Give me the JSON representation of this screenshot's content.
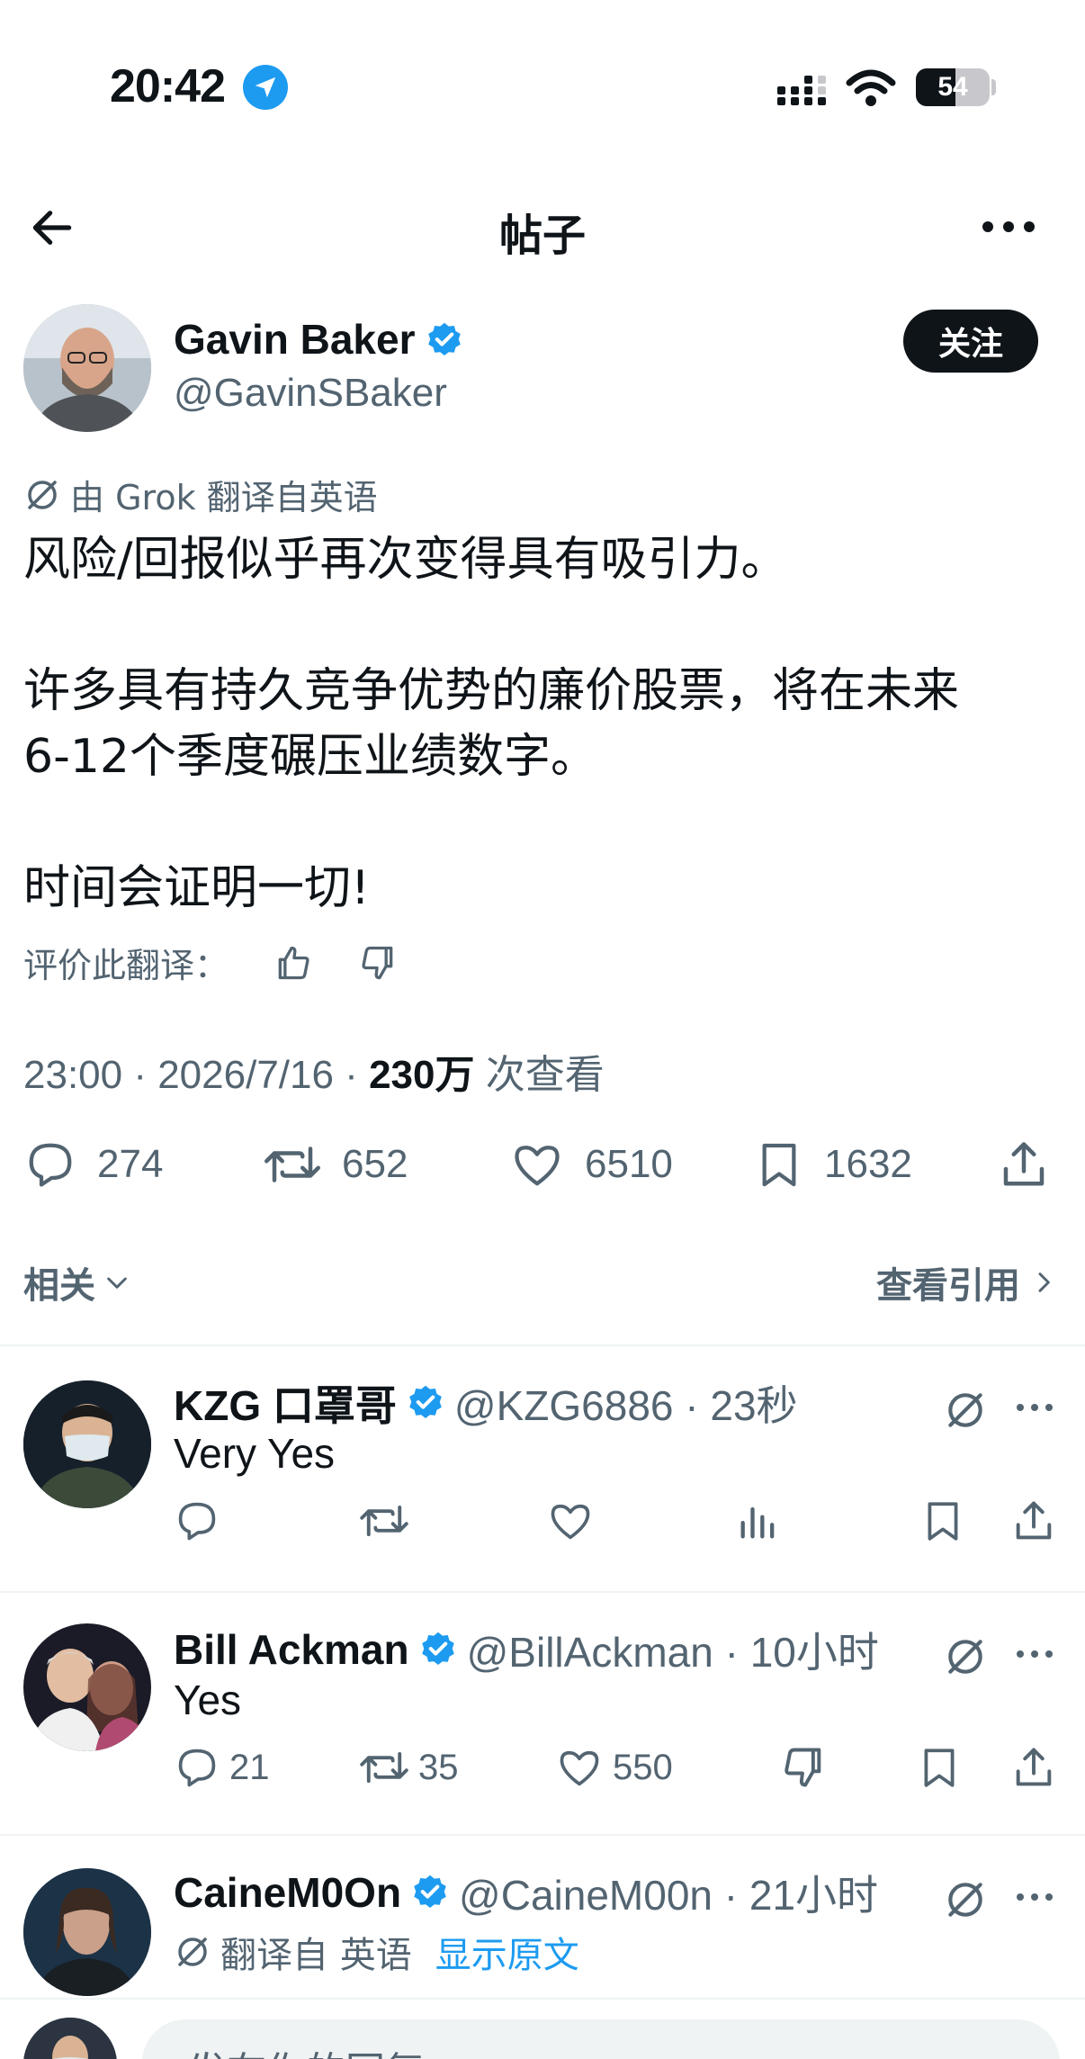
{
  "status_bar": {
    "time": "20:42",
    "battery": "54",
    "battery_level": 0.54,
    "icons": [
      "location-arrow-icon",
      "signal-icon",
      "wifi-icon",
      "battery-icon"
    ]
  },
  "header": {
    "title": "帖子",
    "back_icon": "arrow-left-icon",
    "more_icon": "more-horizontal-icon"
  },
  "post": {
    "author_name": "Gavin Baker",
    "author_handle": "@GavinSBaker",
    "follow_label": "关注",
    "translation_note": "由 Grok 翻译自英语",
    "body": "风险/回报似乎再次变得具有吸引力。\n\n许多具有持久竞争优势的廉价股票，将在未来\n6-12个季度碾压业绩数字。\n\n时间会证明一切!",
    "rate_label": "评价此翻译：",
    "meta_time": "23:00 · 2026/7/16 · ",
    "meta_views": "230万",
    "meta_views_label": " 次查看",
    "stats": {
      "replies": "274",
      "reposts": "652",
      "likes": "6510",
      "bookmarks": "1632"
    }
  },
  "related": {
    "label": "相关",
    "view_quotes": "查看引用"
  },
  "replies": [
    {
      "name": "KZG 口罩哥",
      "handle": "@KZG6886 · 23秒",
      "text": "Very Yes",
      "replies": "",
      "reposts": "",
      "likes": ""
    },
    {
      "name": "Bill Ackman",
      "handle": "@BillAckman · 10小时",
      "text": "Yes",
      "replies": "21",
      "reposts": "35",
      "likes": "550"
    },
    {
      "name": "CaineM0On",
      "handle": "@CaineM00n · 21小时",
      "translation_note": "翻译自 英语",
      "show_original": "显示原文"
    }
  ],
  "compose": {
    "placeholder": "发布你的回复"
  },
  "colors": {
    "accent": "#1d9bf0",
    "text": "#0f1419",
    "muted": "#536471",
    "divider": "#eff3f4"
  }
}
